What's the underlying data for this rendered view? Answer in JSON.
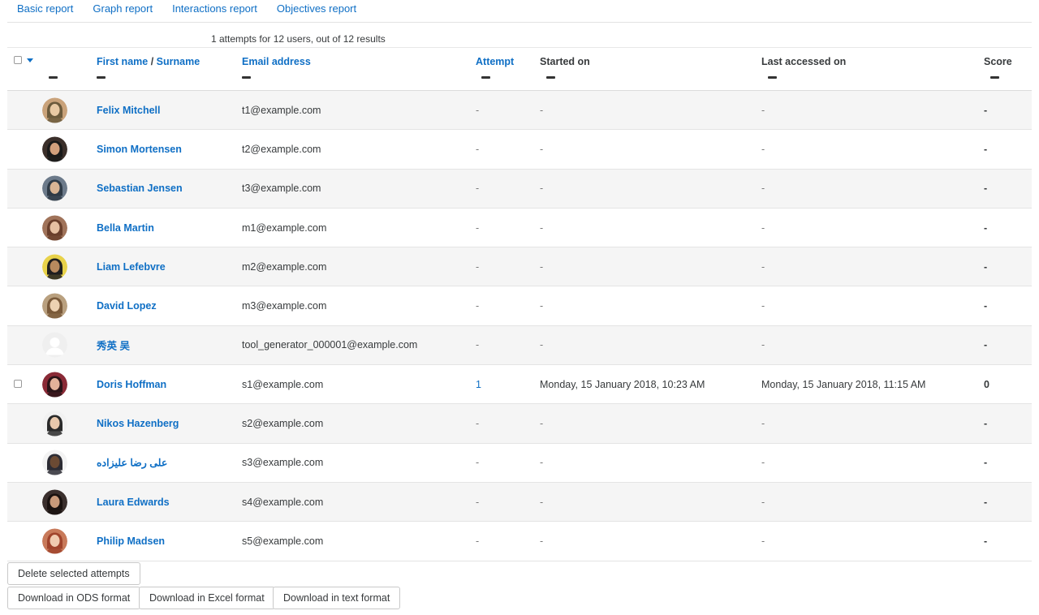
{
  "tabs": [
    "Basic report",
    "Graph report",
    "Interactions report",
    "Objectives report"
  ],
  "summary": "1 attempts for 12 users, out of 12 results",
  "columns": {
    "first_name": "First name",
    "separator": "/",
    "surname": "Surname",
    "email": "Email address",
    "attempt": "Attempt",
    "started": "Started on",
    "last_accessed": "Last accessed on",
    "score": "Score"
  },
  "rows": [
    {
      "name": "Felix Mitchell",
      "email": "t1@example.com",
      "attempt": "-",
      "started": "-",
      "last": "-",
      "score": "-",
      "checkbox": false,
      "avatar": "avatar-1"
    },
    {
      "name": "Simon Mortensen",
      "email": "t2@example.com",
      "attempt": "-",
      "started": "-",
      "last": "-",
      "score": "-",
      "checkbox": false,
      "avatar": "avatar-2"
    },
    {
      "name": "Sebastian Jensen",
      "email": "t3@example.com",
      "attempt": "-",
      "started": "-",
      "last": "-",
      "score": "-",
      "checkbox": false,
      "avatar": "avatar-3"
    },
    {
      "name": "Bella Martin",
      "email": "m1@example.com",
      "attempt": "-",
      "started": "-",
      "last": "-",
      "score": "-",
      "checkbox": false,
      "avatar": "avatar-4"
    },
    {
      "name": "Liam Lefebvre",
      "email": "m2@example.com",
      "attempt": "-",
      "started": "-",
      "last": "-",
      "score": "-",
      "checkbox": false,
      "avatar": "avatar-5"
    },
    {
      "name": "David Lopez",
      "email": "m3@example.com",
      "attempt": "-",
      "started": "-",
      "last": "-",
      "score": "-",
      "checkbox": false,
      "avatar": "avatar-6"
    },
    {
      "name": "秀英 吴",
      "email": "tool_generator_000001@example.com",
      "attempt": "-",
      "started": "-",
      "last": "-",
      "score": "-",
      "checkbox": false,
      "avatar": "default-avatar"
    },
    {
      "name": "Doris Hoffman",
      "email": "s1@example.com",
      "attempt": "1",
      "started": "Monday, 15 January 2018, 10:23 AM",
      "last": "Monday, 15 January 2018, 11:15 AM",
      "score": "0",
      "checkbox": true,
      "avatar": "avatar-8"
    },
    {
      "name": "Nikos Hazenberg",
      "email": "s2@example.com",
      "attempt": "-",
      "started": "-",
      "last": "-",
      "score": "-",
      "checkbox": false,
      "avatar": "avatar-9"
    },
    {
      "name": "علی رضا علیزاده",
      "email": "s3@example.com",
      "attempt": "-",
      "started": "-",
      "last": "-",
      "score": "-",
      "checkbox": false,
      "avatar": "avatar-10"
    },
    {
      "name": "Laura Edwards",
      "email": "s4@example.com",
      "attempt": "-",
      "started": "-",
      "last": "-",
      "score": "-",
      "checkbox": false,
      "avatar": "avatar-11"
    },
    {
      "name": "Philip Madsen",
      "email": "s5@example.com",
      "attempt": "-",
      "started": "-",
      "last": "-",
      "score": "-",
      "checkbox": false,
      "avatar": "avatar-12"
    }
  ],
  "buttons": {
    "delete": "Delete selected attempts",
    "ods": "Download in ODS format",
    "excel": "Download in Excel format",
    "text": "Download in text format"
  },
  "colors": {
    "link": "#0f6fc5",
    "stripe": "#f5f5f5"
  }
}
